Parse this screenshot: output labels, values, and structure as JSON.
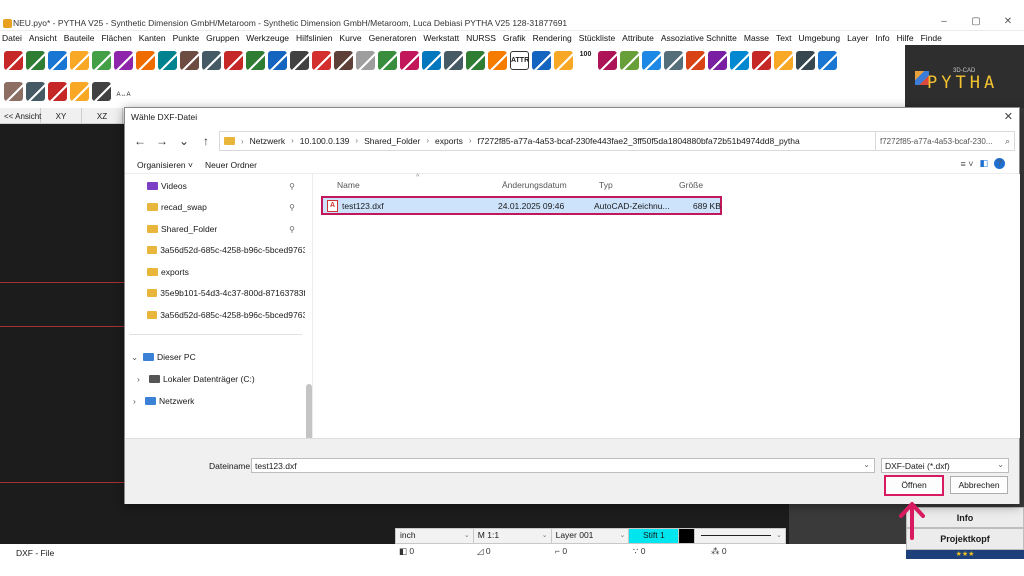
{
  "window": {
    "title": "NEU.pyo* - PYTHA V25 - Synthetic Dimension GmbH/Metaroom - Synthetic Dimension GmbH/Metaroom, Luca Debiasi  PYTHA V25   128-31877691",
    "controls": [
      "–",
      "▢",
      "✕"
    ]
  },
  "menu": [
    "Datei",
    "Ansicht",
    "Bauteile",
    "Flächen",
    "Kanten",
    "Punkte",
    "Gruppen",
    "Werkzeuge",
    "Hilfslinien",
    "Kurve",
    "Generatoren",
    "Werkstatt",
    "NURSS",
    "Grafik",
    "Rendering",
    "Stückliste",
    "Attribute",
    "Assoziative Schnitte",
    "Masse",
    "Text",
    "Umgebung",
    "Layer",
    "Info",
    "Hilfe",
    "Finde"
  ],
  "toolbar": {
    "row1_colors": [
      "#c62828",
      "#2e7d32",
      "#1976d2",
      "#f9a825",
      "#43a047",
      "#8e24aa",
      "#ef6c00",
      "#00838f",
      "#6d4c41",
      "#455a64",
      "#c62828",
      "#2e7d32",
      "#1565c0",
      "#424242",
      "#d32f2f",
      "#5d4037",
      "#9e9e9e",
      "#388e3c",
      "#c2185b",
      "#0277bd",
      "#455a64",
      "#2e7d32",
      "#f57c00",
      "#263238",
      "#1565c0",
      "#f9a825",
      "#00695c",
      "#ad1457",
      "#689f38",
      "#1e88e5",
      "#546e7a",
      "#d84315",
      "#7b1fa2",
      "#0288d1",
      "#c62828",
      "#f9a825",
      "#37474f",
      "#1976d2"
    ],
    "row2_colors": [
      "#8d6e63",
      "#455a64",
      "#c62828",
      "#f9a825",
      "#424242"
    ],
    "text_tool": "A↔A",
    "attr_label": "ATTR",
    "hundred_label": "100"
  },
  "logo": {
    "text": "PYTHA",
    "sub": "3D-CAD"
  },
  "viewtabs": [
    "<< Ansicht",
    "XY",
    "XZ"
  ],
  "dialog": {
    "title": "Wähle DXF-Datei",
    "close": "✕",
    "nav": {
      "back": "←",
      "forward": "→",
      "down": "⌄",
      "up": "↑"
    },
    "path": [
      "Netzwerk",
      "10.100.0.139",
      "Shared_Folder",
      "exports",
      "f7272f85-a77a-4a53-bcaf-230fe443fae2_3ff50f5da1804880bfa72b51b4974dd8_pytha"
    ],
    "search_text": "f7272f85-a77a-4a53-bcaf-230...",
    "commands": {
      "organize": "Organisieren ˅",
      "new_folder": "Neuer Ordner"
    },
    "help": "?",
    "nav_items": [
      {
        "label": "Videos",
        "pinned": true,
        "icon": "video-folder-icon"
      },
      {
        "label": "recad_swap",
        "pinned": true,
        "icon": "folder-icon"
      },
      {
        "label": "Shared_Folder",
        "pinned": true,
        "icon": "folder-icon"
      },
      {
        "label": "3a56d52d-685c-4258-b96c-5bced976371",
        "pinned": false,
        "icon": "folder-icon"
      },
      {
        "label": "exports",
        "pinned": false,
        "icon": "folder-icon"
      },
      {
        "label": "35e9b101-54d3-4c37-800d-87163783fd9",
        "pinned": false,
        "icon": "folder-icon"
      },
      {
        "label": "3a56d52d-685c-4258-b96c-5bced976371",
        "pinned": false,
        "icon": "folder-icon"
      }
    ],
    "tree": [
      {
        "label": "Dieser PC",
        "chevron": "⌄"
      },
      {
        "label": "Lokaler Datenträger (C:)",
        "chevron": "›"
      },
      {
        "label": "Netzwerk",
        "chevron": "›"
      }
    ],
    "columns": {
      "name": "Name",
      "date": "Änderungsdatum",
      "type": "Typ",
      "size": "Größe"
    },
    "files": [
      {
        "name": "test123.dxf",
        "date": "24.01.2025 09:46",
        "type": "AutoCAD-Zeichnu...",
        "size": "689 KB"
      }
    ],
    "filename_label": "Dateiname:",
    "filename_value": "test123.dxf",
    "filetype_value": "DXF-Datei (*.dxf)",
    "open_button": "Öffnen",
    "cancel_button": "Abbrechen"
  },
  "statusbar": {
    "unit": "inch",
    "scale": "M 1:1",
    "layer": "Layer 001",
    "pen": "Stift 1",
    "counts": [
      "0",
      "0",
      "0",
      "0",
      "0"
    ],
    "bottom_left": "DXF - File"
  },
  "right_panel": {
    "info": "Info",
    "projekt": "Projektkopf",
    "stars": "★★★"
  },
  "colors": {
    "accent_highlight": "#d81b60",
    "selection": "#cde3fb",
    "pen_color": "#00e5ee"
  }
}
